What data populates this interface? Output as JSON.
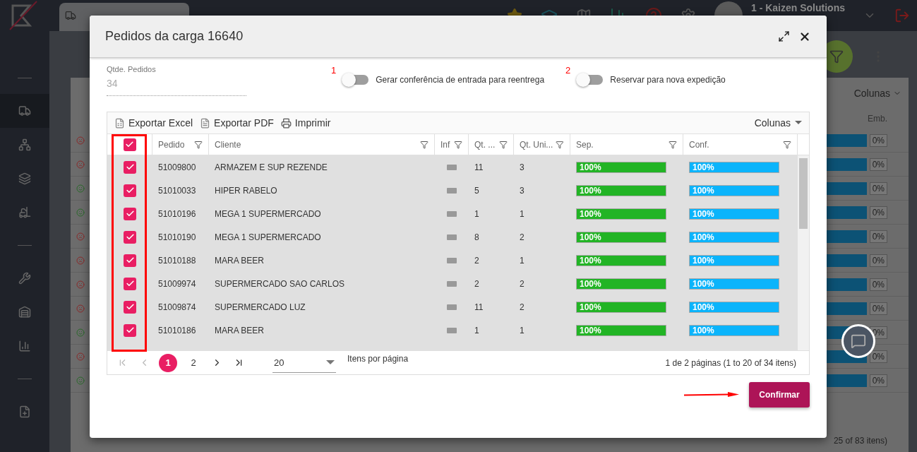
{
  "app": {
    "user": "1 - Kaizen Solutions"
  },
  "background": {
    "columns_button": "Colunas",
    "column_header": "Emb.",
    "footer": "25 of 83 itens)",
    "rows": [
      {
        "kind": "sad",
        "level": 1,
        "value": "0%"
      },
      {
        "kind": "sad",
        "level": 1,
        "value": "0%"
      },
      {
        "kind": "happy",
        "level": 1,
        "value": "0%"
      },
      {
        "kind": "happy",
        "level": 1,
        "value": "0%"
      },
      {
        "kind": "sad",
        "level": 1,
        "value": "0%"
      },
      {
        "kind": "sad",
        "level": 1,
        "value": "0%"
      },
      {
        "kind": "sad",
        "level": 1,
        "value": "0%"
      },
      {
        "kind": "sad",
        "level": 1,
        "value": "0%"
      },
      {
        "kind": "happy",
        "level": 1,
        "value": "0%"
      },
      {
        "kind": "sad",
        "level": 1,
        "value": "0%"
      },
      {
        "kind": "happy",
        "level": 1,
        "value": "0%"
      }
    ]
  },
  "modal": {
    "title": "Pedidos da carga 16640",
    "qty_field": {
      "label": "Qtde. Pedidos",
      "value": "34"
    },
    "toggles": [
      {
        "marker": "1",
        "label": "Gerar conferência de entrada para reentrega",
        "on": false
      },
      {
        "marker": "2",
        "label": "Reservar para nova expedição",
        "on": false
      }
    ],
    "toolbar": [
      {
        "kind": "excel",
        "label": "Exportar Excel"
      },
      {
        "kind": "pdf",
        "label": "Exportar PDF"
      },
      {
        "kind": "print",
        "label": "Imprimir"
      }
    ],
    "columns_button": "Colunas",
    "header_checked": true,
    "columns": [
      "Pedido",
      "Cliente",
      "Inf",
      "Qt. ...",
      "Qt. Uni...",
      "Sep.",
      "Conf."
    ],
    "rows": [
      {
        "checked": true,
        "pedido": "51009800",
        "cliente": "ARMAZEM E SUP REZENDE",
        "qt": "11",
        "qt_uni": "3",
        "sep": {
          "label": "100%",
          "level": 1
        },
        "conf": {
          "label": "100%",
          "level": 1
        }
      },
      {
        "checked": true,
        "pedido": "51010033",
        "cliente": "HIPER RABELO",
        "qt": "5",
        "qt_uni": "3",
        "sep": {
          "label": "100%",
          "level": 1
        },
        "conf": {
          "label": "100%",
          "level": 1
        }
      },
      {
        "checked": true,
        "pedido": "51010196",
        "cliente": "MEGA 1 SUPERMERCADO",
        "qt": "1",
        "qt_uni": "1",
        "sep": {
          "label": "100%",
          "level": 1
        },
        "conf": {
          "label": "100%",
          "level": 1
        }
      },
      {
        "checked": true,
        "pedido": "51010190",
        "cliente": "MEGA 1 SUPERMERCADO",
        "qt": "8",
        "qt_uni": "2",
        "sep": {
          "label": "100%",
          "level": 1
        },
        "conf": {
          "label": "100%",
          "level": 1
        }
      },
      {
        "checked": true,
        "pedido": "51010188",
        "cliente": "MARA BEER",
        "qt": "2",
        "qt_uni": "1",
        "sep": {
          "label": "100%",
          "level": 1
        },
        "conf": {
          "label": "100%",
          "level": 1
        }
      },
      {
        "checked": true,
        "pedido": "51009974",
        "cliente": "SUPERMERCADO SAO CARLOS",
        "qt": "2",
        "qt_uni": "2",
        "sep": {
          "label": "100%",
          "level": 1
        },
        "conf": {
          "label": "100%",
          "level": 1
        }
      },
      {
        "checked": true,
        "pedido": "51009874",
        "cliente": "SUPERMERCADO LUZ",
        "qt": "11",
        "qt_uni": "2",
        "sep": {
          "label": "100%",
          "level": 1
        },
        "conf": {
          "label": "100%",
          "level": 1
        }
      },
      {
        "checked": true,
        "pedido": "51010186",
        "cliente": "MARA BEER",
        "qt": "1",
        "qt_uni": "1",
        "sep": {
          "label": "100%",
          "level": 1
        },
        "conf": {
          "label": "100%",
          "level": 1
        }
      }
    ],
    "pages": [
      {
        "label": "1",
        "selected": true
      },
      {
        "label": "2",
        "selected": false
      }
    ],
    "page_size": "20",
    "page_size_label": "Itens por página",
    "summary": "1 de 2 páginas (1 to 20 of 34 itens)",
    "confirm": "Confirmar"
  }
}
